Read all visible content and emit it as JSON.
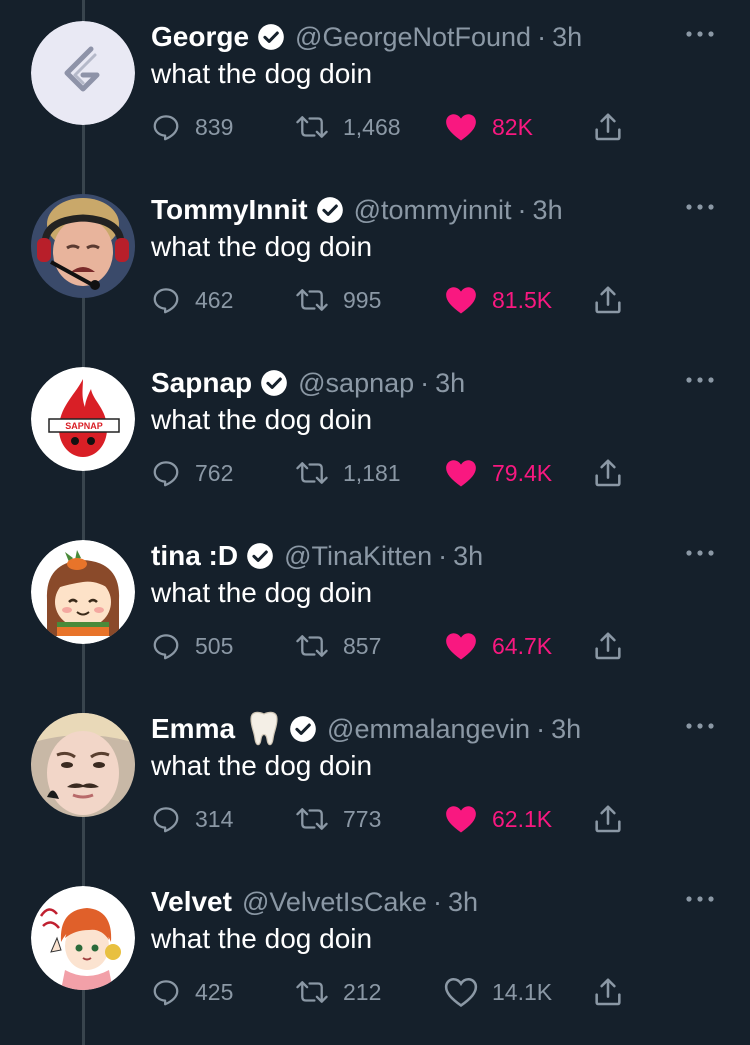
{
  "colors": {
    "background": "#15202b",
    "text": "#ffffff",
    "secondary": "#8b98a5",
    "like_active": "#f91880",
    "verified": "#ffffff",
    "thread_line": "#38444d"
  },
  "icons": {
    "reply": "speech-bubble-icon",
    "retweet": "retweet-arrows-icon",
    "like": "heart-icon",
    "share": "share-upload-icon",
    "verified": "verified-badge-icon",
    "more": "more-dots-icon"
  },
  "tweets": [
    {
      "name": "George",
      "verified": true,
      "handle": "@GeorgeNotFound",
      "dot": "·",
      "time": "3h",
      "text": "what the dog doin",
      "replies": "839",
      "retweets": "1,468",
      "likes": "82K",
      "liked": true
    },
    {
      "name": "TommyInnit",
      "verified": true,
      "handle": "@tommyinnit",
      "dot": "·",
      "time": "3h",
      "text": "what the dog doin",
      "replies": "462",
      "retweets": "995",
      "likes": "81.5K",
      "liked": true
    },
    {
      "name": "Sapnap",
      "verified": true,
      "handle": "@sapnap",
      "dot": "·",
      "time": "3h",
      "text": "what the dog doin",
      "replies": "762",
      "retweets": "1,181",
      "likes": "79.4K",
      "liked": true,
      "avatar_text": "SAPNAP"
    },
    {
      "name": "tina :D",
      "verified": true,
      "handle": "@TinaKitten",
      "dot": "·",
      "time": "3h",
      "text": "what the dog doin",
      "replies": "505",
      "retweets": "857",
      "likes": "64.7K",
      "liked": true
    },
    {
      "name": "Emma",
      "emoji": "tooth-emoji-icon",
      "verified": true,
      "handle": "@emmalangevin",
      "dot": "·",
      "time": "3h",
      "text": "what the dog doin",
      "replies": "314",
      "retweets": "773",
      "likes": "62.1K",
      "liked": true
    },
    {
      "name": "Velvet",
      "verified": false,
      "handle": "@VelvetIsCake",
      "dot": "·",
      "time": "3h",
      "text": "what the dog doin",
      "replies": "425",
      "retweets": "212",
      "likes": "14.1K",
      "liked": false
    }
  ]
}
